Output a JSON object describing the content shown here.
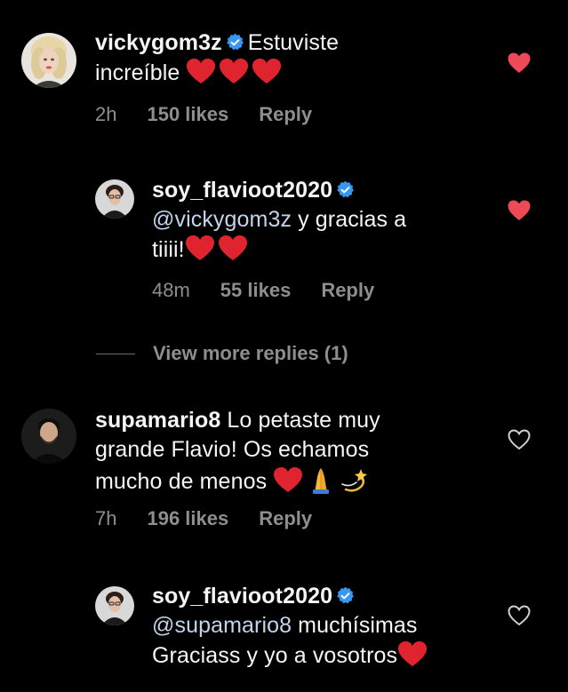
{
  "comments": [
    {
      "username": "vickygom3z",
      "verified": true,
      "text_line1": "Estuviste",
      "text_line2": "increíble",
      "time": "2h",
      "likes": "150 likes",
      "reply": "Reply",
      "liked": true
    },
    {
      "username": "soy_flavioot2020",
      "verified": true,
      "mention": "@vickygom3z",
      "text_after_mention": " y gracias a",
      "text_line2": "tiiii!",
      "time": "48m",
      "likes": "55 likes",
      "reply": "Reply",
      "liked": true
    },
    {
      "username": "supamario8",
      "verified": false,
      "text_line1": "Lo petaste muy",
      "text_line2": "grande Flavio! Os echamos",
      "text_line3": "mucho de menos",
      "time": "7h",
      "likes": "196 likes",
      "reply": "Reply",
      "liked": false
    },
    {
      "username": "soy_flavioot2020",
      "verified": true,
      "mention": "@supamario8",
      "text_after_mention": " muchísimas",
      "text_line2": "Graciass y yo a vosotros",
      "liked": false
    }
  ],
  "view_more_replies": "View more replies (1)",
  "colors": {
    "background": "#000000",
    "text": "#f5f5f5",
    "meta": "#8e8e8e",
    "mention": "#c2d4ec",
    "verified_blue": "#3897f0",
    "heart_red": "#ed4956"
  },
  "icons": {
    "verified": "verified-badge-icon",
    "liked": "heart-filled-icon",
    "unliked": "heart-outline-icon",
    "emoji_heart": "red-heart-emoji",
    "emoji_pray": "folded-hands-emoji",
    "emoji_dizzy": "dizzy-emoji"
  }
}
